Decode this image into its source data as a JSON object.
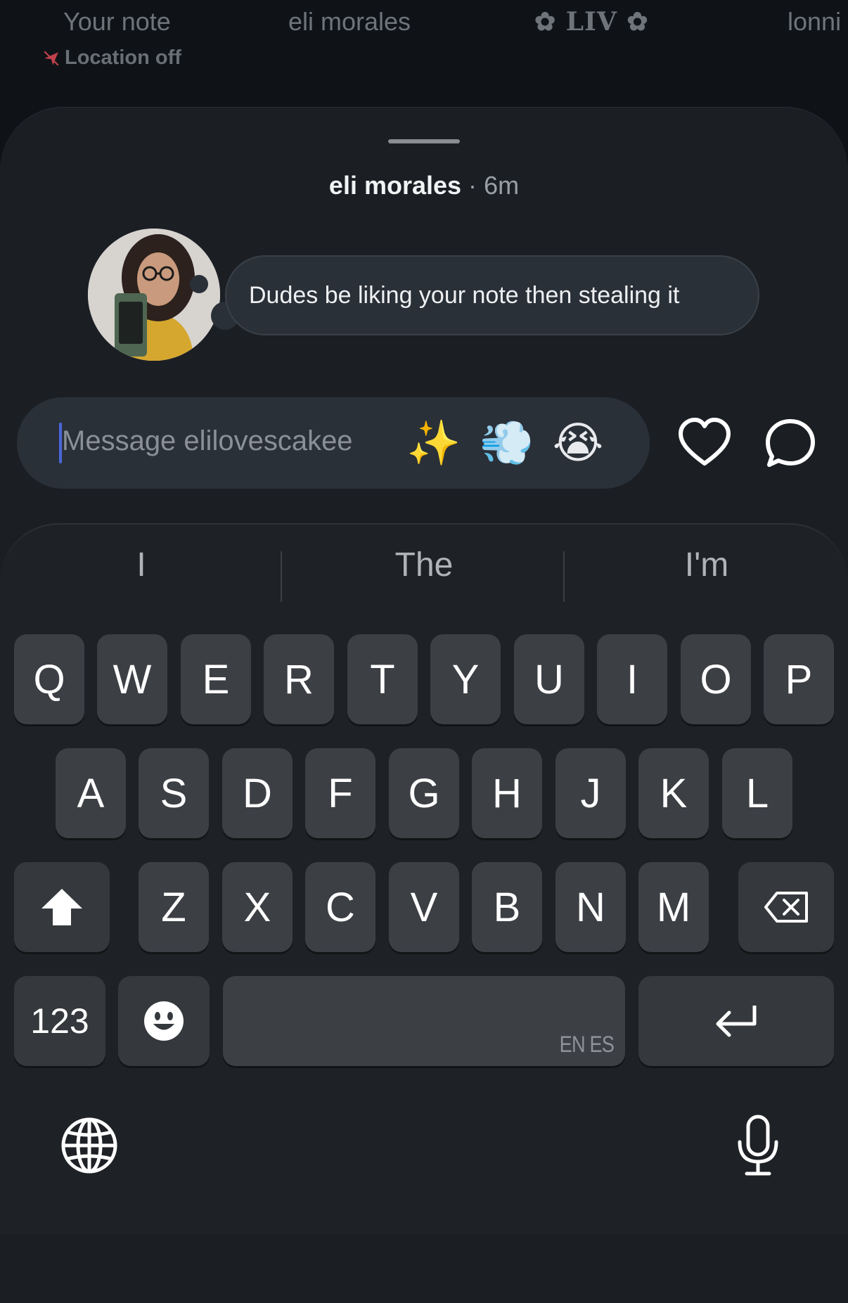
{
  "notes": [
    {
      "name": "Your note"
    },
    {
      "name": "eli morales"
    },
    {
      "name": "✿ LIV ✿"
    },
    {
      "name": "lonni"
    }
  ],
  "location_status": "Location off",
  "sheet": {
    "author": "eli morales",
    "separator": "·",
    "time": "6m",
    "note_text": "Dudes be liking your note then stealing it"
  },
  "composer": {
    "placeholder": "Message elilovescakee",
    "quick_reactions": [
      "✨",
      "💨",
      "😭"
    ]
  },
  "keyboard": {
    "suggestions": [
      "I",
      "The",
      "I'm"
    ],
    "row1": [
      "Q",
      "W",
      "E",
      "R",
      "T",
      "Y",
      "U",
      "I",
      "O",
      "P"
    ],
    "row2": [
      "A",
      "S",
      "D",
      "F",
      "G",
      "H",
      "J",
      "K",
      "L"
    ],
    "row3": [
      "Z",
      "X",
      "C",
      "V",
      "B",
      "N",
      "M"
    ],
    "numbers_label": "123",
    "space_languages": "EN ES"
  },
  "icons": {
    "location": "location-off-icon",
    "heart": "heart-icon",
    "comment": "comment-bubble-icon",
    "shift": "shift-icon",
    "backspace": "backspace-icon",
    "emoji": "emoji-face-icon",
    "return": "return-icon",
    "globe": "globe-icon",
    "mic": "microphone-icon"
  },
  "colors": {
    "background": "#0f1317",
    "sheet": "#1b1f24",
    "bubble": "#2a3038",
    "key": "#3c3f44",
    "caret": "#4a67d9"
  }
}
